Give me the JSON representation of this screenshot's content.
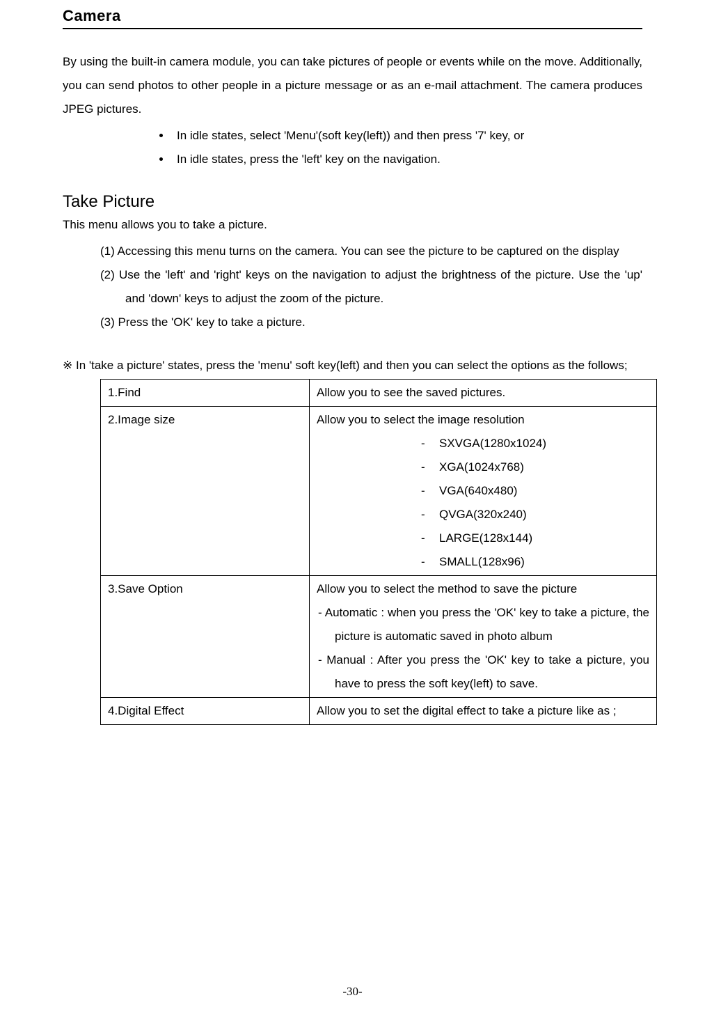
{
  "title": "Camera",
  "intro": "By using the built-in camera module, you can take pictures of people or events while on the move. Additionally, you can send photos to other people in a picture message or as an e-mail attachment. The camera produces JPEG pictures.",
  "bullets": [
    "In idle states, select 'Menu'(soft key(left)) and then press '7' key, or",
    "In idle states, press the 'left' key on the navigation."
  ],
  "section": {
    "title": "Take Picture",
    "subtitle": "This menu allows you to take a picture.",
    "items": [
      "(1) Accessing this menu turns on the camera. You can see the picture to be captured on the display",
      "(2) Use the 'left' and 'right' keys on the navigation to adjust the brightness of the picture. Use the 'up' and 'down' keys to adjust the zoom of the picture.",
      "(3) Press the 'OK' key to take a picture."
    ]
  },
  "note": "※ In 'take a picture' states, press the 'menu' soft key(left) and then you can select the options as the follows;",
  "table": {
    "rows": [
      {
        "left": "1.Find",
        "right_intro": "Allow you to see the saved pictures."
      },
      {
        "left": "2.Image size",
        "right_intro": "Allow you to select the image resolution",
        "sizes": [
          "SXVGA(1280x1024)",
          "XGA(1024x768)",
          "VGA(640x480)",
          "QVGA(320x240)",
          "LARGE(128x144)",
          "SMALL(128x96)"
        ]
      },
      {
        "left": "3.Save Option",
        "right_intro": "Allow you to select the method to save the picture",
        "save_items": [
          "-  Automatic : when you press the 'OK' key to take a picture, the picture is automatic saved in photo album",
          "-  Manual : After you press the 'OK' key to take a picture, you have to press the soft key(left) to save."
        ]
      },
      {
        "left": "4.Digital Effect",
        "right_intro": "Allow you to set the digital effect to take a picture like as ;"
      }
    ]
  },
  "page_number": "-30-"
}
